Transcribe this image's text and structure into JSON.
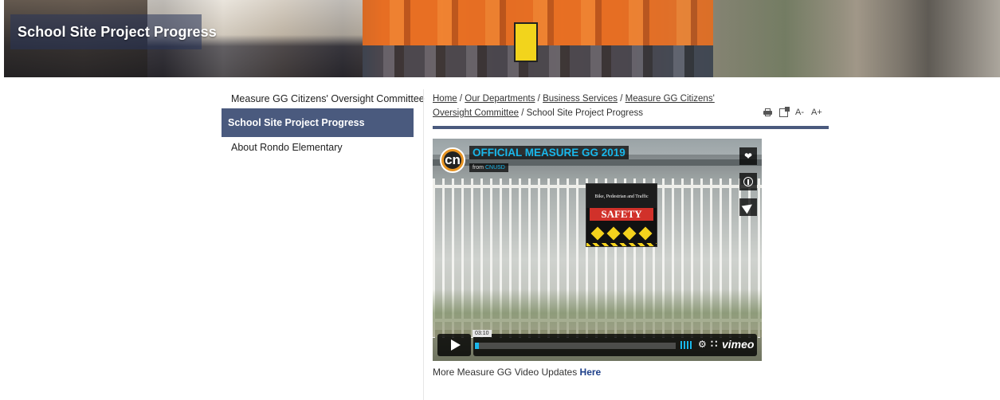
{
  "banner": {
    "title": "School Site Project Progress"
  },
  "sidebar": {
    "items": [
      {
        "label": "Measure GG Citizens' Oversight Committee"
      },
      {
        "label": "School Site Project Progress",
        "active": true
      },
      {
        "label": "About Rondo Elementary"
      }
    ]
  },
  "breadcrumb": {
    "items": [
      {
        "label": "Home"
      },
      {
        "label": "Our Departments"
      },
      {
        "label": "Business Services"
      },
      {
        "label": "Measure GG Citizens' Oversight Committee"
      },
      {
        "label": "School Site Project Progress"
      }
    ],
    "separator": " / "
  },
  "tools": {
    "decrease_label": "A-",
    "increase_label": "A+"
  },
  "video": {
    "title": "OFFICIAL MEASURE GG 2019",
    "from_prefix": "from",
    "from_channel": "CNUSD",
    "logo_text": "cn",
    "time": "03:10",
    "progress": 0.02,
    "vimeo_label": "vimeo",
    "poster": {
      "heading": "Bike, Pedestrian and Traffic",
      "sign": "SAFETY"
    }
  },
  "caption": {
    "text": "More Measure GG Video Updates",
    "link": "Here"
  },
  "colors": {
    "accent": "#4a5a7e",
    "link": "#1d3f8a",
    "vimeo": "#19b7ea"
  }
}
